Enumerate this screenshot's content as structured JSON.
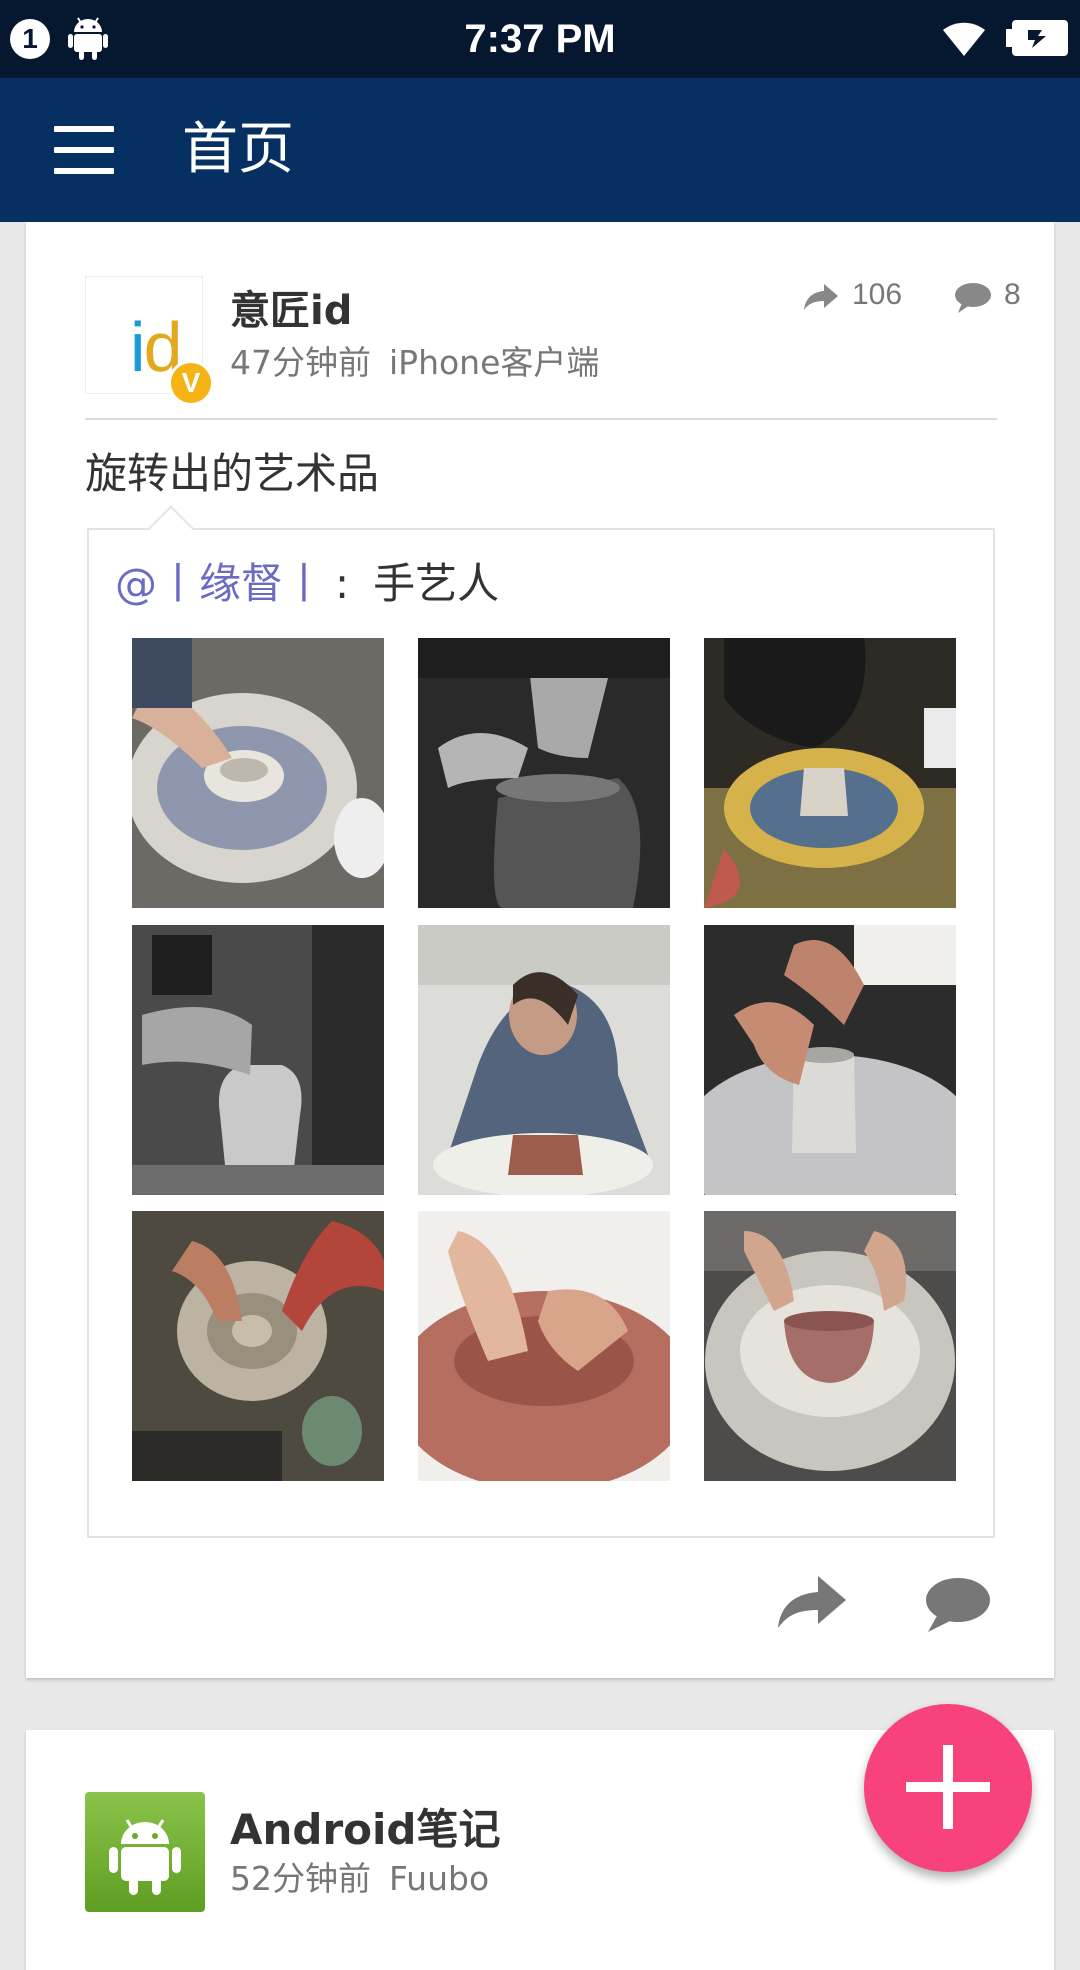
{
  "status_bar": {
    "notification_count": "1",
    "time": "7:37 PM"
  },
  "app_bar": {
    "title": "首页"
  },
  "posts": [
    {
      "author": "意匠id",
      "avatar_text": "id",
      "verified_badge": "V",
      "time": "47分钟前",
      "source": "iPhone客户端",
      "repost_count": "106",
      "comment_count": "8",
      "text": "旋转出的艺术品",
      "retweet": {
        "mention": "@丨缘督丨",
        "separator": ":",
        "text": "手艺人",
        "image_count": 9
      }
    },
    {
      "author": "Android笔记",
      "time": "52分钟前",
      "source": "Fuubo"
    }
  ],
  "icons": {
    "menu": "hamburger-icon",
    "repost": "share-arrow-icon",
    "comment": "comment-bubble-icon",
    "compose": "plus-icon",
    "wifi": "wifi-icon",
    "battery": "battery-icon",
    "android": "android-icon"
  },
  "colors": {
    "status_bar": "#06182f",
    "app_bar": "#053061",
    "fab": "#f7427c",
    "mention": "#6b6bc4",
    "verified": "#f5b416"
  }
}
